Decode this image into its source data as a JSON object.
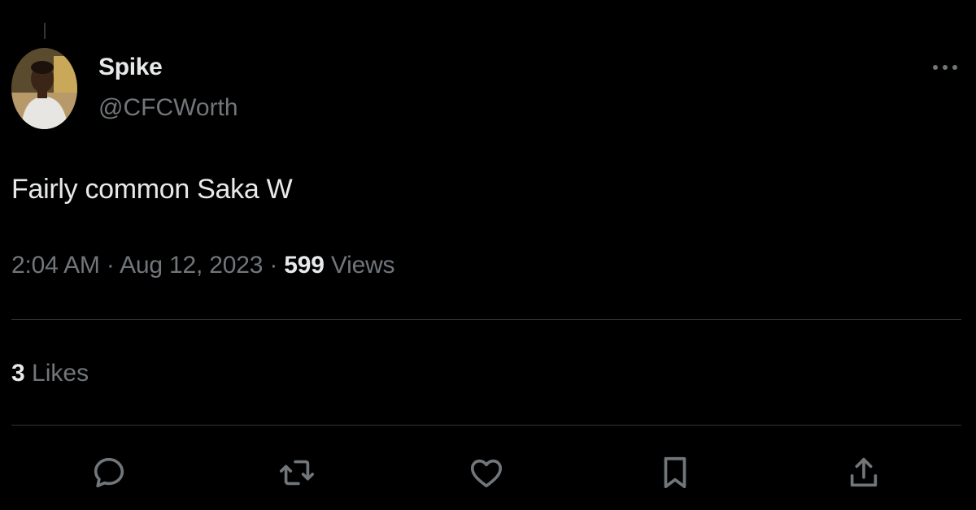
{
  "tweet": {
    "author": {
      "display_name": "Spike",
      "handle": "@CFCWorth"
    },
    "text": "Fairly common Saka W",
    "time": "2:04 AM",
    "separator": "·",
    "date": "Aug 12, 2023",
    "views_count": "599",
    "views_label": "Views",
    "likes_count": "3",
    "likes_label": "Likes"
  },
  "actions": {
    "icons": [
      "chat-bubble-icon",
      "retweet-icon",
      "heart-icon",
      "bookmark-icon",
      "share-icon"
    ]
  },
  "icons": {
    "more": "more-horizontal-icon",
    "avatar": "profile-photo"
  },
  "colors": {
    "background": "#000000",
    "primary_text": "#e7e9ea",
    "secondary_text": "#71767b",
    "divider": "#2f3336"
  }
}
